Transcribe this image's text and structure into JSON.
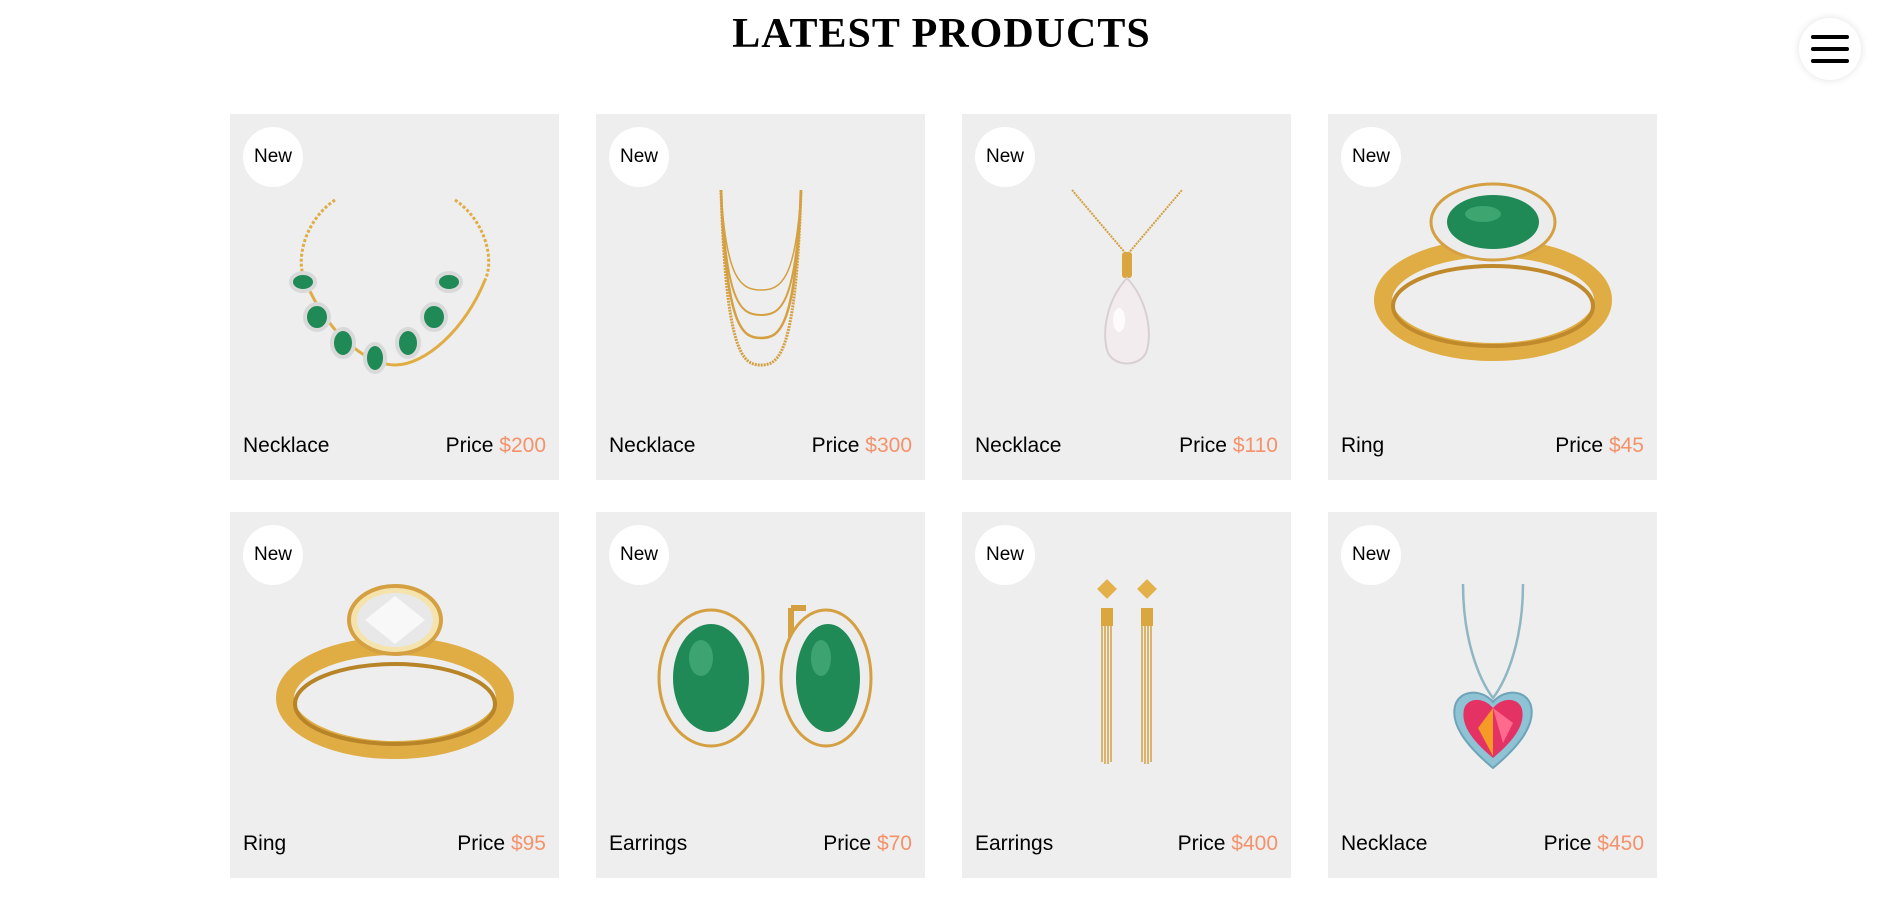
{
  "page": {
    "title": "LATEST PRODUCTS"
  },
  "menu": {
    "icon": "hamburger-menu-icon"
  },
  "colors": {
    "card_bg": "#eeeeee",
    "price_accent": "#f4926b",
    "gold": "#e0ad45",
    "emerald": "#1f8a55"
  },
  "products": [
    {
      "badge": "New",
      "name": "Necklace",
      "price_label": "Price",
      "price": "$200",
      "image": "emerald-bracelet"
    },
    {
      "badge": "New",
      "name": "Necklace",
      "price_label": "Price",
      "price": "$300",
      "image": "gold-layered-chains"
    },
    {
      "badge": "New",
      "name": "Necklace",
      "price_label": "Price",
      "price": "$110",
      "image": "pearl-pendant"
    },
    {
      "badge": "New",
      "name": "Ring",
      "price_label": "Price",
      "price": "$45",
      "image": "emerald-ring"
    },
    {
      "badge": "New",
      "name": "Ring",
      "price_label": "Price",
      "price": "$95",
      "image": "diamond-ring"
    },
    {
      "badge": "New",
      "name": "Earrings",
      "price_label": "Price",
      "price": "$70",
      "image": "emerald-earrings"
    },
    {
      "badge": "New",
      "name": "Earrings",
      "price_label": "Price",
      "price": "$400",
      "image": "gold-tassel-earrings"
    },
    {
      "badge": "New",
      "name": "Necklace",
      "price_label": "Price",
      "price": "$450",
      "image": "heart-ruby-pendant"
    }
  ]
}
